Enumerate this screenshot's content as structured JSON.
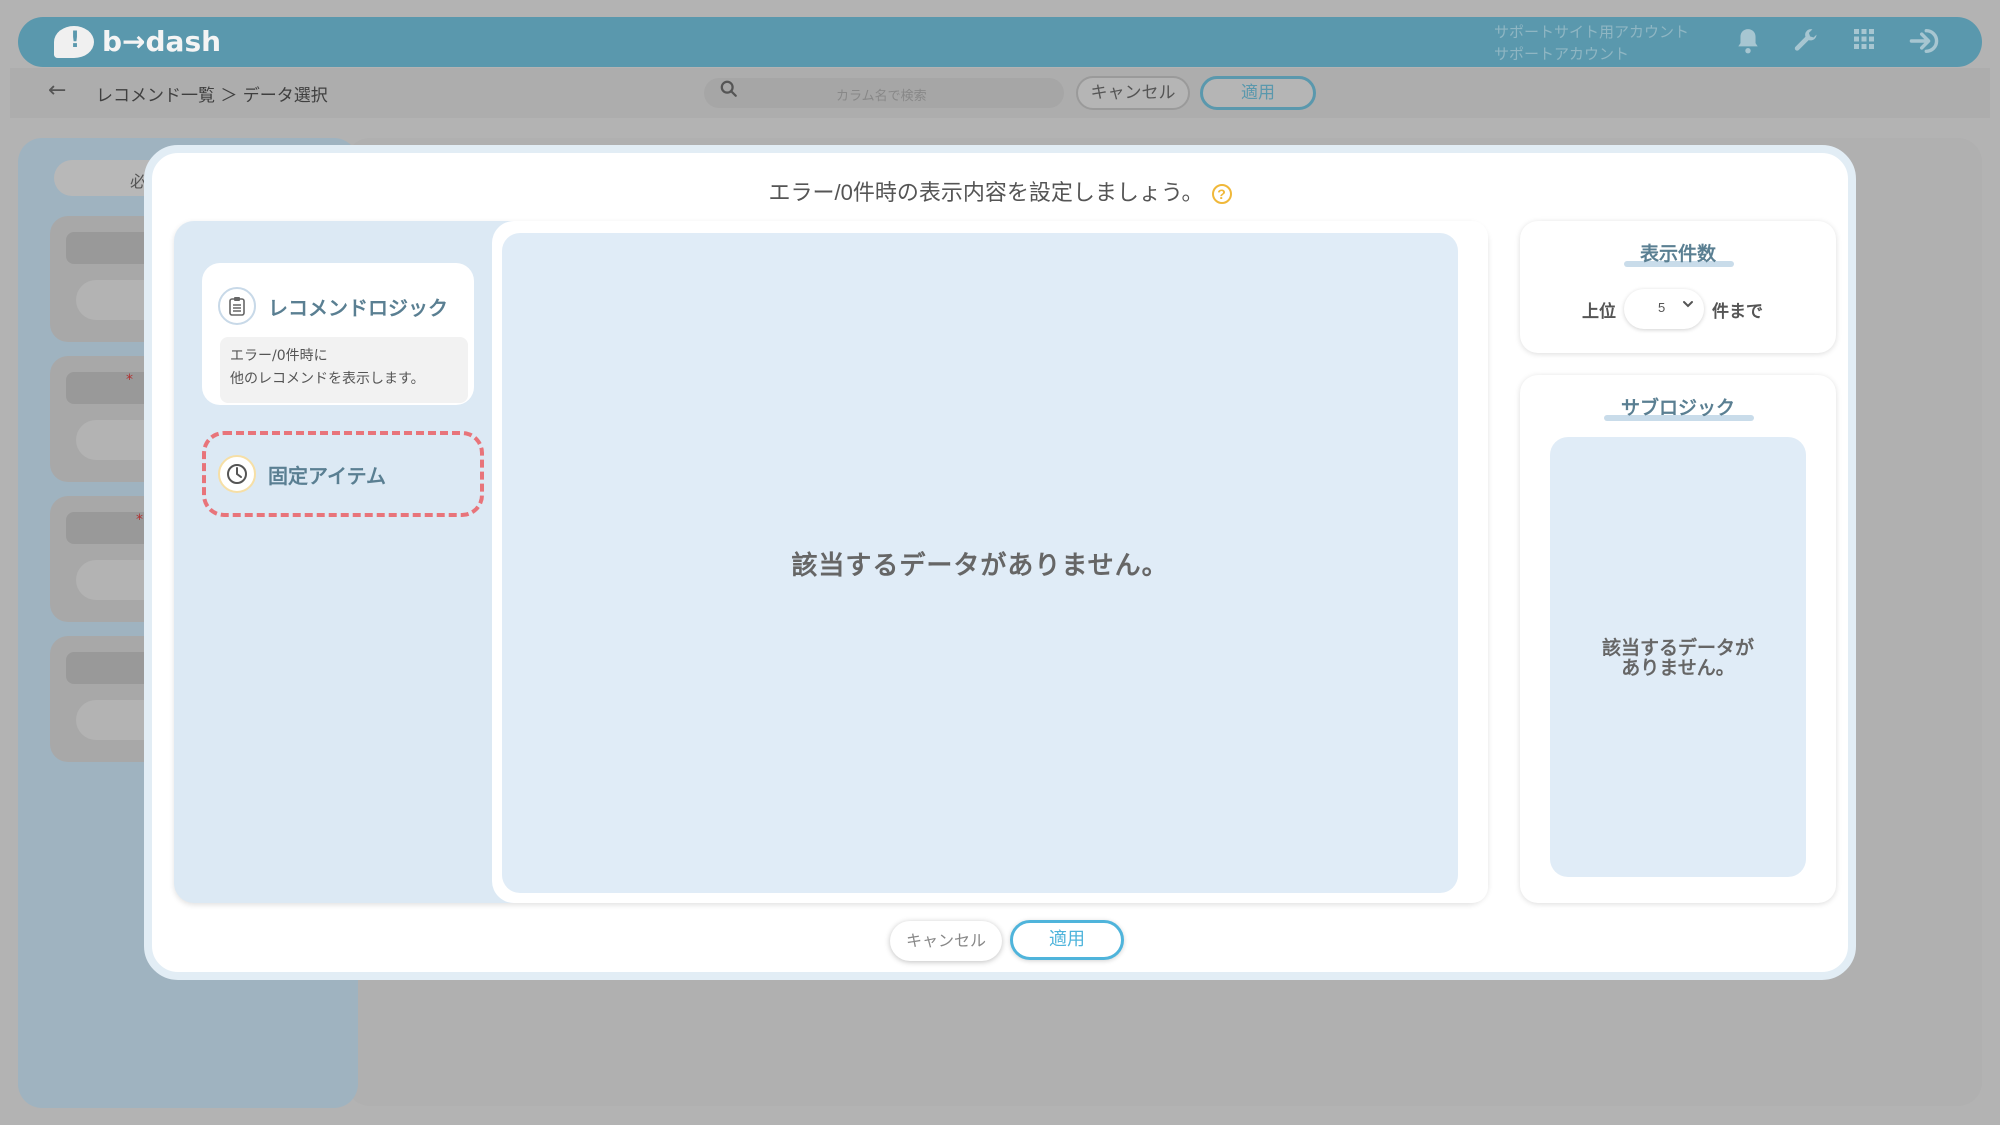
{
  "header": {
    "logo_text": "b→dash",
    "account_line1": "サポートサイト用アカウント",
    "account_line2": "サポートアカウント",
    "icons": [
      "bell-icon",
      "wrench-icon",
      "grid-icon",
      "logout-icon"
    ]
  },
  "subbar": {
    "breadcrumb": "レコメンド一覧 ＞ データ選択",
    "search_placeholder": "カラム名で検索",
    "cancel_label": "キャンセル",
    "apply_label": "適用"
  },
  "background": {
    "pill_label": "必"
  },
  "modal": {
    "title": "エラー/0件時の表示内容を設定しましょう。",
    "logic_items": [
      {
        "label": "レコメンドロジック",
        "icon": "clipboard-icon",
        "description_line1": "エラー/0件時に",
        "description_line2": "他のレコメンドを表示します。"
      },
      {
        "label": "固定アイテム",
        "icon": "clock-icon"
      }
    ],
    "main_empty_text": "該当するデータがありません。",
    "count_card": {
      "title": "表示件数",
      "prefix": "上位",
      "value": "5",
      "suffix": "件まで"
    },
    "sub_logic": {
      "title": "サブロジック",
      "empty_line1": "該当するデータが",
      "empty_line2": "ありません。"
    },
    "cancel_label": "キャンセル",
    "apply_label": "適用"
  },
  "colors": {
    "brand": "#5a98ad",
    "accent_blue": "#4fb4db",
    "highlight_dash": "#e8747a",
    "help_yellow": "#f0b83a"
  }
}
